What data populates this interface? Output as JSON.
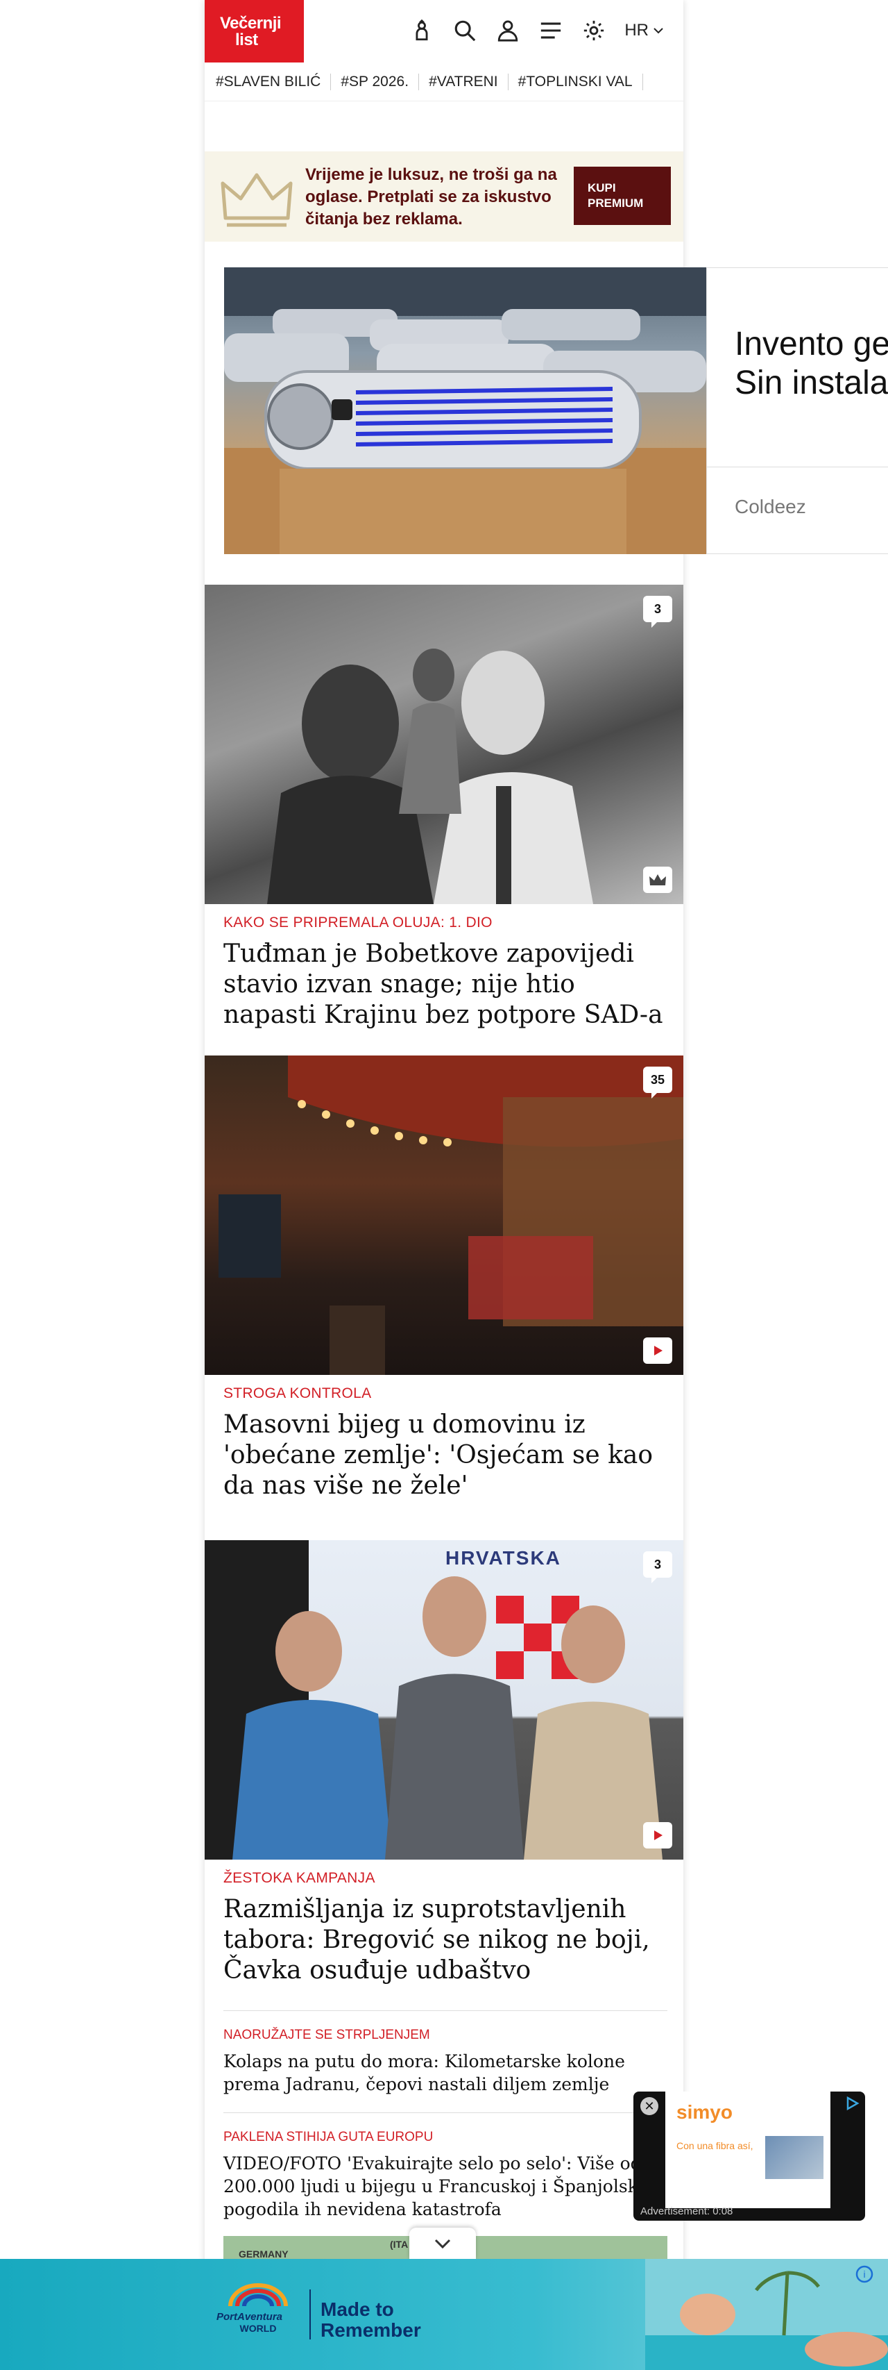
{
  "header": {
    "logo_line1": "Večernji",
    "logo_line2": "list",
    "lang": "HR"
  },
  "tags": [
    "#SLAVEN BILIĆ",
    "#SP 2026.",
    "#VATRENI",
    "#TOPLINSKI VAL"
  ],
  "premium": {
    "text": "Vrijeme je luksuz, ne troši ga na oglase. Pretplati se za iskustvo čitanja bez reklama.",
    "button": "KUPI PREMIUM"
  },
  "ad": {
    "title_line1": "Invento ge",
    "title_line2": "Sin instala",
    "brand": "Coldeez"
  },
  "articles": [
    {
      "kicker": "KAKO SE PRIPREMALA OLUJA: 1. DIO",
      "title": "Tuđman je Bobetkove zapovijedi stavio izvan snage; nije htio napasti Krajinu bez potpore SAD-a",
      "comments": "3",
      "corner_icon": "crown-icon"
    },
    {
      "kicker": "STROGA KONTROLA",
      "title": "Masovni bijeg u domovinu iz 'obećane zemlje': 'Osjećam se kao da nas više ne žele'",
      "comments": "35",
      "corner_icon": "play-icon"
    },
    {
      "kicker": "ŽESTOKA KAMPANJA",
      "title": "Razmišljanja iz suprotstavljenih tabora: Bregović se nikog ne boji, Čavka osuđuje udbaštvo",
      "comments": "3",
      "corner_icon": "play-icon",
      "photo_sign": "HRVATSKA"
    }
  ],
  "small_articles": [
    {
      "kicker": "NAORUŽAJTE SE STRPLJENJEM",
      "title": "Kolaps na putu do mora: Kilometarske kolone prema Jadranu, čepovi nastali diljem zemlje"
    },
    {
      "kicker": "PAKLENA STIHIJA GUTA EUROPU",
      "title": "VIDEO/FOTO 'Evakuirajte selo po selo': Više od 200.000 ljudi u bijegu u Francuskoj i Španjolskoj, pogodila ih nevidena katastrofa"
    }
  ],
  "map_snippet": {
    "label_left": "GERMANY",
    "label_mid": "(ITA"
  },
  "float_ad": {
    "brand": "simyo",
    "subtext": "Con una fibra así,",
    "label": "Advertisement: 0:08"
  },
  "bottom_ad": {
    "brand_line1": "PortAventura",
    "brand_line2": "WORLD",
    "slogan_line1": "Made to",
    "slogan_line2": "Remember"
  },
  "colors": {
    "brand_red": "#e01b24",
    "kicker_red": "#d21f26",
    "premium_bg": "#f7f4e8",
    "premium_btn": "#5b1010"
  }
}
